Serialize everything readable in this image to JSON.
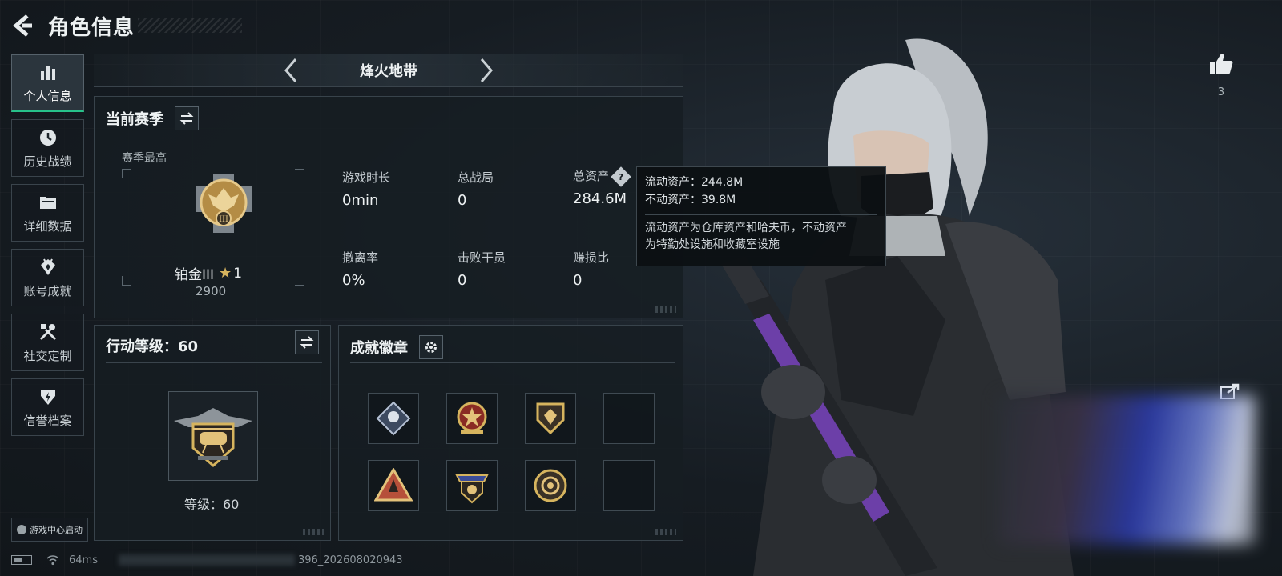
{
  "header": {
    "title": "角色信息"
  },
  "sidebar": {
    "items": [
      {
        "label": "个人信息",
        "icon": "bar-chart-icon",
        "active": true
      },
      {
        "label": "历史战绩",
        "icon": "history-icon"
      },
      {
        "label": "详细数据",
        "icon": "folder-icon"
      },
      {
        "label": "账号成就",
        "icon": "achievement-icon"
      },
      {
        "label": "社交定制",
        "icon": "tools-icon"
      },
      {
        "label": "信誉档案",
        "icon": "shield-icon"
      }
    ],
    "game_center": "游戏中心启动"
  },
  "mode": {
    "name": "烽火地带"
  },
  "season": {
    "title": "当前赛季",
    "best_label": "赛季最高",
    "rank_name": "铂金III",
    "rank_stars": "1",
    "rank_points": "2900",
    "stats": [
      {
        "label": "游戏时长",
        "value": "0min"
      },
      {
        "label": "总战局",
        "value": "0"
      },
      {
        "label": "总资产",
        "value": "284.6M"
      },
      {
        "label": "撤离率",
        "value": "0%"
      },
      {
        "label": "击败干员",
        "value": "0"
      },
      {
        "label": "赚损比",
        "value": "0"
      }
    ]
  },
  "tooltip": {
    "liquid": "流动资产：244.8M",
    "fixed": "不动资产：39.8M",
    "desc_line1": "流动资产为仓库资产和哈夫币，不动资产",
    "desc_line2": "为特勤处设施和收藏室设施"
  },
  "level": {
    "title": "行动等级：60",
    "level_text": "等级：60"
  },
  "achievements": {
    "title": "成就徽章",
    "badges": [
      "diamond-badge",
      "star-badge",
      "shield-badge",
      "empty",
      "triangle-badge",
      "winged-badge",
      "round-badge",
      "empty"
    ]
  },
  "like": {
    "count": "3"
  },
  "status": {
    "ping": "64ms",
    "build_id": "396_202608020943"
  },
  "colors": {
    "accent": "#27c28a",
    "gold": "#d6b45e"
  }
}
